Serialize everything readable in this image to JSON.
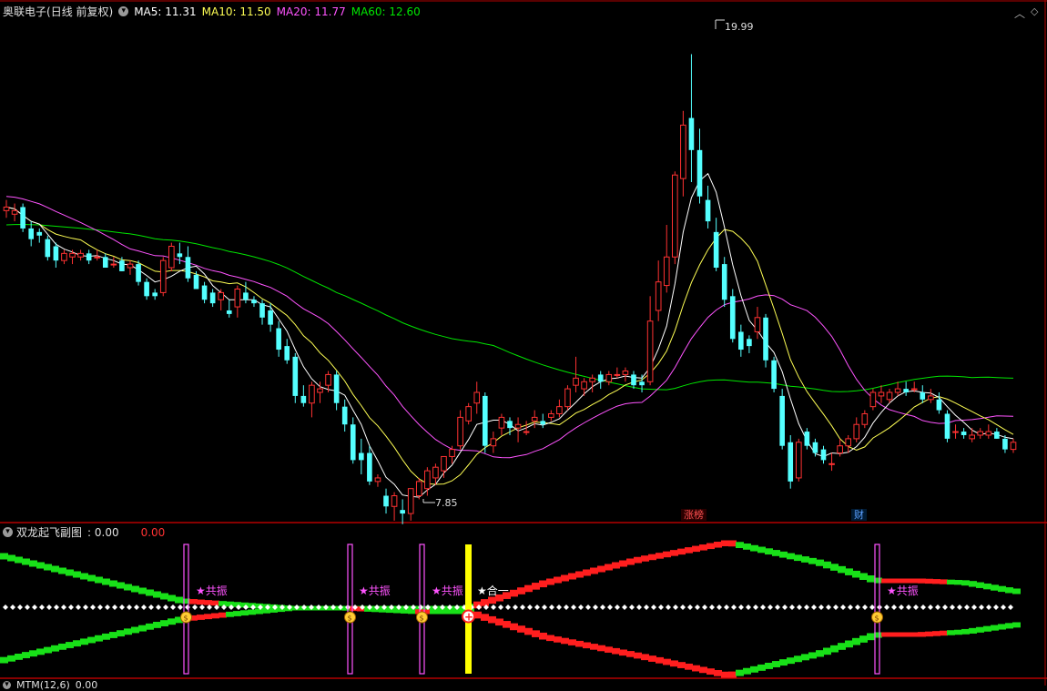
{
  "main_header": {
    "stock_name": "奥联电子",
    "period": "(日线 前复权)",
    "ma5_label": "MA5: 11.31",
    "ma10_label": "MA10: 11.50",
    "ma20_label": "MA20: 11.77",
    "ma60_label": "MA60: 12.60"
  },
  "window_controls": {
    "up_icon": "chevron-up-icon",
    "nav_icon": "diamond-nav-icon"
  },
  "price_annotations": {
    "high_label": "19.99",
    "low_label": "7.85"
  },
  "badges": {
    "limit_list": "涨榜",
    "finance": "财"
  },
  "sub_header": {
    "indicator_name": "双龙起飞副图",
    "value1": ": 0.00",
    "value2": "0.00"
  },
  "signals": {
    "resonance_1": "★共振",
    "resonance_2": "★共振",
    "resonance_3": "★共振",
    "merge": "★合一",
    "resonance_4": "★共振"
  },
  "bottom_header": {
    "indicator": "MTM(12,6)",
    "value": "0.00"
  },
  "colors": {
    "up": "#ff3232",
    "down": "#54ffff",
    "ma5": "#ffffff",
    "ma10": "#ffff54",
    "ma20": "#ff54ff",
    "ma60": "#00e600",
    "border": "#b40000"
  },
  "chart_data": {
    "type": "candlestick",
    "price_high": 19.99,
    "price_low": 7.85,
    "ylim": [
      7.0,
      21.0
    ],
    "ohlc": [
      [
        15.6,
        15.9,
        15.4,
        15.7
      ],
      [
        15.5,
        15.8,
        15.3,
        15.6
      ],
      [
        15.7,
        15.8,
        15.0,
        15.1
      ],
      [
        15.1,
        15.3,
        14.6,
        14.8
      ],
      [
        15.0,
        15.1,
        14.7,
        14.9
      ],
      [
        14.8,
        14.9,
        14.2,
        14.3
      ],
      [
        14.6,
        14.7,
        14.0,
        14.2
      ],
      [
        14.2,
        14.5,
        14.1,
        14.4
      ],
      [
        14.3,
        14.5,
        14.1,
        14.4
      ],
      [
        14.3,
        14.5,
        14.2,
        14.4
      ],
      [
        14.4,
        14.5,
        14.1,
        14.2
      ],
      [
        14.3,
        14.5,
        14.2,
        14.3
      ],
      [
        14.3,
        14.4,
        14.0,
        14.0
      ],
      [
        14.1,
        14.3,
        14.0,
        14.1
      ],
      [
        14.2,
        14.3,
        13.9,
        13.9
      ],
      [
        14.0,
        14.2,
        13.8,
        14.1
      ],
      [
        14.1,
        14.2,
        13.5,
        13.6
      ],
      [
        13.6,
        13.7,
        13.1,
        13.2
      ],
      [
        13.3,
        13.4,
        13.1,
        13.2
      ],
      [
        13.3,
        14.3,
        13.2,
        14.2
      ],
      [
        14.0,
        14.7,
        13.9,
        14.6
      ],
      [
        14.4,
        14.7,
        14.1,
        14.3
      ],
      [
        14.3,
        14.6,
        13.6,
        13.7
      ],
      [
        13.8,
        13.9,
        13.4,
        13.4
      ],
      [
        13.5,
        13.6,
        13.0,
        13.1
      ],
      [
        13.3,
        13.4,
        12.9,
        13.0
      ],
      [
        13.1,
        13.4,
        12.8,
        13.3
      ],
      [
        12.8,
        13.1,
        12.6,
        12.7
      ],
      [
        12.9,
        13.5,
        12.6,
        13.4
      ],
      [
        13.3,
        13.6,
        13.0,
        13.1
      ],
      [
        13.1,
        13.2,
        12.9,
        13.0
      ],
      [
        13.0,
        13.1,
        12.4,
        12.6
      ],
      [
        12.8,
        13.0,
        12.2,
        12.4
      ],
      [
        12.3,
        12.5,
        11.5,
        11.7
      ],
      [
        11.8,
        12.0,
        11.3,
        11.4
      ],
      [
        11.5,
        11.6,
        10.2,
        10.4
      ],
      [
        10.4,
        10.7,
        10.1,
        10.2
      ],
      [
        10.2,
        10.8,
        9.8,
        10.7
      ],
      [
        10.5,
        10.8,
        10.2,
        10.6
      ],
      [
        10.7,
        11.1,
        10.5,
        11.0
      ],
      [
        11.0,
        11.1,
        10.0,
        10.2
      ],
      [
        10.1,
        10.3,
        9.4,
        9.6
      ],
      [
        9.6,
        9.8,
        8.5,
        8.6
      ],
      [
        8.8,
        9.2,
        8.2,
        8.6
      ],
      [
        8.8,
        9.0,
        7.9,
        8.0
      ],
      [
        8.0,
        8.2,
        7.85,
        8.1
      ],
      [
        7.6,
        7.8,
        7.1,
        7.3
      ],
      [
        7.3,
        7.7,
        6.9,
        7.6
      ],
      [
        7.2,
        7.5,
        6.8,
        7.1
      ],
      [
        7.1,
        7.8,
        6.9,
        7.8
      ],
      [
        7.6,
        8.1,
        7.5,
        8.0
      ],
      [
        7.8,
        8.4,
        7.6,
        8.3
      ],
      [
        8.1,
        8.5,
        7.9,
        8.4
      ],
      [
        8.3,
        8.7,
        8.1,
        8.7
      ],
      [
        8.7,
        9.0,
        8.5,
        8.9
      ],
      [
        9.0,
        10.0,
        8.9,
        9.8
      ],
      [
        9.7,
        10.2,
        9.6,
        10.1
      ],
      [
        10.2,
        10.8,
        9.9,
        10.5
      ],
      [
        10.4,
        10.5,
        8.8,
        9.0
      ],
      [
        9.0,
        9.4,
        8.8,
        9.2
      ],
      [
        9.5,
        9.9,
        9.3,
        9.8
      ],
      [
        9.7,
        9.8,
        9.3,
        9.5
      ],
      [
        9.5,
        9.8,
        9.1,
        9.6
      ],
      [
        9.4,
        9.7,
        9.3,
        9.4
      ],
      [
        9.7,
        10.0,
        9.5,
        9.8
      ],
      [
        9.7,
        9.9,
        9.5,
        9.6
      ],
      [
        9.8,
        10.0,
        9.7,
        9.9
      ],
      [
        9.9,
        10.3,
        9.8,
        10.1
      ],
      [
        10.1,
        10.7,
        10.0,
        10.6
      ],
      [
        10.7,
        11.5,
        10.5,
        10.9
      ],
      [
        10.6,
        10.9,
        10.4,
        10.8
      ],
      [
        10.8,
        11.0,
        10.5,
        10.9
      ],
      [
        11.0,
        11.1,
        10.6,
        10.8
      ],
      [
        10.8,
        11.1,
        10.7,
        11.0
      ],
      [
        11.0,
        11.2,
        10.9,
        11.0
      ],
      [
        11.0,
        11.2,
        10.8,
        11.1
      ],
      [
        11.0,
        11.1,
        10.6,
        10.7
      ],
      [
        10.8,
        11.0,
        10.5,
        10.7
      ],
      [
        10.8,
        13.2,
        10.7,
        12.5
      ],
      [
        12.8,
        14.2,
        12.5,
        13.6
      ],
      [
        13.5,
        15.2,
        13.3,
        14.3
      ],
      [
        14.3,
        16.7,
        14.1,
        16.6
      ],
      [
        16.5,
        18.4,
        16.0,
        18.0
      ],
      [
        18.2,
        19.99,
        16.4,
        17.3
      ],
      [
        17.3,
        17.9,
        15.8,
        16.0
      ],
      [
        15.9,
        16.3,
        15.1,
        15.3
      ],
      [
        15.0,
        15.4,
        13.9,
        14.0
      ],
      [
        14.1,
        14.3,
        12.9,
        13.1
      ],
      [
        13.2,
        13.4,
        11.9,
        12.0
      ],
      [
        12.2,
        12.4,
        11.5,
        11.7
      ],
      [
        12.0,
        12.1,
        11.6,
        11.8
      ],
      [
        12.2,
        12.9,
        12.0,
        12.6
      ],
      [
        12.6,
        12.7,
        11.2,
        11.4
      ],
      [
        11.4,
        11.5,
        10.5,
        10.6
      ],
      [
        10.4,
        10.6,
        8.9,
        9.0
      ],
      [
        9.1,
        9.3,
        7.8,
        8.0
      ],
      [
        8.1,
        9.2,
        8.0,
        9.1
      ],
      [
        9.4,
        9.5,
        8.9,
        9.0
      ],
      [
        9.1,
        9.2,
        8.7,
        8.8
      ],
      [
        8.9,
        9.0,
        8.5,
        8.6
      ],
      [
        8.5,
        8.8,
        8.3,
        8.5
      ],
      [
        8.8,
        9.2,
        8.7,
        9.0
      ],
      [
        9.0,
        9.3,
        8.8,
        9.2
      ],
      [
        9.2,
        9.8,
        9.1,
        9.6
      ],
      [
        9.6,
        10.0,
        9.5,
        9.9
      ],
      [
        10.1,
        10.6,
        10.0,
        10.5
      ],
      [
        10.4,
        10.7,
        10.2,
        10.5
      ],
      [
        10.3,
        10.6,
        10.2,
        10.5
      ],
      [
        10.5,
        10.8,
        10.4,
        10.6
      ],
      [
        10.6,
        10.8,
        10.4,
        10.5
      ],
      [
        10.6,
        10.8,
        10.5,
        10.6
      ],
      [
        10.5,
        10.7,
        10.2,
        10.3
      ],
      [
        10.3,
        10.6,
        10.2,
        10.4
      ],
      [
        10.3,
        10.5,
        9.9,
        10.0
      ],
      [
        9.9,
        10.0,
        9.1,
        9.2
      ],
      [
        9.4,
        9.6,
        9.2,
        9.4
      ],
      [
        9.4,
        9.5,
        9.2,
        9.3
      ],
      [
        9.2,
        9.5,
        9.1,
        9.3
      ],
      [
        9.3,
        9.5,
        9.2,
        9.4
      ],
      [
        9.3,
        9.6,
        9.2,
        9.4
      ],
      [
        9.4,
        9.5,
        9.2,
        9.2
      ],
      [
        9.2,
        9.3,
        8.8,
        8.9
      ],
      [
        8.9,
        9.2,
        8.8,
        9.1
      ]
    ]
  }
}
